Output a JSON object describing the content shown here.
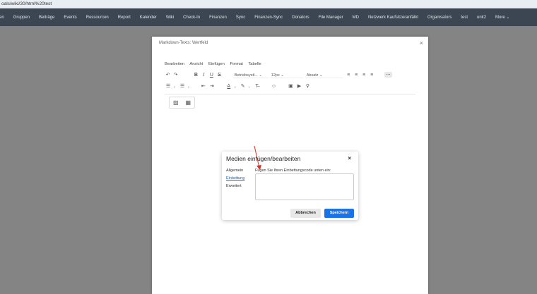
{
  "url": "oals/wiki/30/html%20test",
  "nav": [
    "en",
    "Gruppen",
    "Beiträge",
    "Events",
    "Ressourcen",
    "Report",
    "Kalender",
    "Wiki",
    "Check-In",
    "Finanzen",
    "Sync",
    "Finanzen-Sync",
    "Donators",
    "File Manager",
    "MD",
    "Netzwerk Kaufsitzeranfälkt",
    "Organisators",
    "test",
    "unit2",
    "More"
  ],
  "editor": {
    "title": "Markdown-Texts: Wertfeld",
    "close": "×",
    "menu": [
      "Bearbeiten",
      "Ansicht",
      "Einfügen",
      "Format",
      "Tabelle"
    ],
    "block_select": "Betriebsystl...",
    "size_select": "12px",
    "para_select": "Absatz"
  },
  "dialog": {
    "title": "Medien einfügen/bearbeiten",
    "close": "×",
    "tabs": [
      "Allgemein",
      "Einbettung",
      "Erweitert"
    ],
    "label": "Fügen Sie Ihren Einbettungscode unten ein:",
    "cancel": "Abbrechen",
    "save": "Speichern"
  },
  "colors": {
    "accent": "#1b73e8",
    "arrow": "#d93025"
  }
}
